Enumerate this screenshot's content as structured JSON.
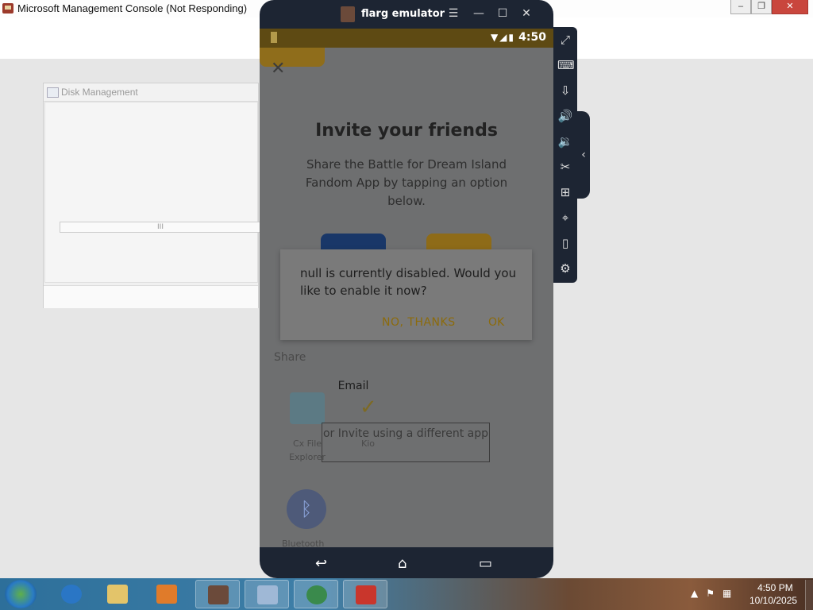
{
  "mmc": {
    "title": "Microsoft Management Console (Not Responding)",
    "min": "‒",
    "max": "❐",
    "close": "✕",
    "disk_title": "Disk Management",
    "scroll_mark": "III"
  },
  "emulator": {
    "title": "flarg emulator",
    "menu_icon": "☰",
    "min_icon": "—",
    "max_icon": "☐",
    "close_icon": "✕",
    "status_time": "4:50",
    "status_icons": "▼◢▮"
  },
  "app": {
    "close": "✕",
    "title": "Invite your friends",
    "subtitle": "Share the Battle for Dream Island Fandom App by tapping an option below.",
    "email_label": "Email",
    "share_label": "Share",
    "invite_different": "or Invite using a different app",
    "apps": [
      {
        "label": "Cx File Explorer",
        "icon": "folder-icon"
      },
      {
        "label": "Kio",
        "icon": "kio-icon"
      },
      {
        "label": "Bluetooth",
        "icon": "bluetooth-icon"
      }
    ]
  },
  "dialog": {
    "message": "null is currently disabled. Would you like to enable it now?",
    "no_label": "NO, THANKS",
    "ok_label": "OK"
  },
  "nav": {
    "back": "↩",
    "home": "⌂",
    "recents": "▭"
  },
  "side_toolbar": {
    "items": [
      "fullscreen-icon",
      "keyboard-icon",
      "apk-install-icon",
      "volume-up-icon",
      "volume-down-icon",
      "scissors-icon",
      "add-window-icon",
      "location-icon",
      "shake-icon",
      "settings-icon"
    ],
    "glyphs": [
      "⤢",
      "⌨",
      "⇩",
      "🔊",
      "🔉",
      "✂",
      "⊞",
      "⌖",
      "▯",
      "⚙"
    ],
    "collapse": "‹"
  },
  "taskbar": {
    "time": "4:50 PM",
    "date": "10/10/2025",
    "tray_icons": "▲⚑▦"
  }
}
